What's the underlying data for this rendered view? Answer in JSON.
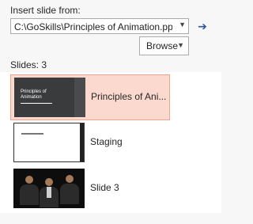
{
  "insert": {
    "label": "Insert slide from:",
    "path_value": "C:\\GoSkills\\Principles of Animation.ppt",
    "go_icon": "arrow-right-icon"
  },
  "browse": {
    "label": "Browse"
  },
  "slides": {
    "count_label": "Slides: 3",
    "items": [
      {
        "name": "Principles of Ani...",
        "thumb_title": "Principles of\nAnimation",
        "selected": true
      },
      {
        "name": "Staging",
        "selected": false
      },
      {
        "name": "Slide 3",
        "selected": false
      }
    ]
  },
  "colors": {
    "selected_bg": "#fbd9cf",
    "selected_border": "#f2a38e",
    "accent": "#2b579a"
  }
}
